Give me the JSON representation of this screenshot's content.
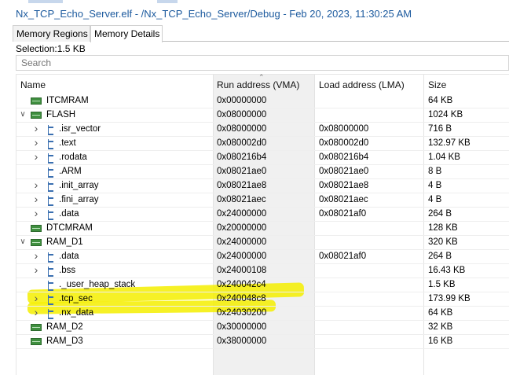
{
  "window": {
    "title": "Nx_TCP_Echo_Server.elf - /Nx_TCP_Echo_Server/Debug - Feb 20, 2023, 11:30:25 AM"
  },
  "tabs": [
    {
      "label": "Memory Regions",
      "active": false
    },
    {
      "label": "Memory Details",
      "active": true
    }
  ],
  "selection": "Selection:1.5 KB",
  "search": {
    "placeholder": "Search",
    "value": ""
  },
  "table": {
    "columns": [
      "Name",
      "Run address (VMA)",
      "Load address (LMA)",
      "Size"
    ],
    "rows": [
      {
        "name": "ITCMRAM",
        "kind": "memory",
        "twisty": "",
        "vma": "0x00000000",
        "lma": "",
        "size": "64 KB"
      },
      {
        "name": "FLASH",
        "kind": "memory",
        "twisty": "expanded",
        "vma": "0x08000000",
        "lma": "",
        "size": "1024 KB"
      },
      {
        "name": ".isr_vector",
        "kind": "section",
        "twisty": "collapsed",
        "vma": "0x08000000",
        "lma": "0x08000000",
        "size": "716 B"
      },
      {
        "name": ".text",
        "kind": "section",
        "twisty": "collapsed",
        "vma": "0x080002d0",
        "lma": "0x080002d0",
        "size": "132.97 KB"
      },
      {
        "name": ".rodata",
        "kind": "section",
        "twisty": "collapsed",
        "vma": "0x080216b4",
        "lma": "0x080216b4",
        "size": "1.04 KB"
      },
      {
        "name": ".ARM",
        "kind": "section",
        "twisty": "",
        "vma": "0x08021ae0",
        "lma": "0x08021ae0",
        "size": "8 B"
      },
      {
        "name": ".init_array",
        "kind": "section",
        "twisty": "collapsed",
        "vma": "0x08021ae8",
        "lma": "0x08021ae8",
        "size": "4 B"
      },
      {
        "name": ".fini_array",
        "kind": "section",
        "twisty": "collapsed",
        "vma": "0x08021aec",
        "lma": "0x08021aec",
        "size": "4 B"
      },
      {
        "name": ".data",
        "kind": "section",
        "twisty": "collapsed",
        "vma": "0x24000000",
        "lma": "0x08021af0",
        "size": "264 B"
      },
      {
        "name": "DTCMRAM",
        "kind": "memory",
        "twisty": "",
        "vma": "0x20000000",
        "lma": "",
        "size": "128 KB"
      },
      {
        "name": "RAM_D1",
        "kind": "memory",
        "twisty": "expanded",
        "vma": "0x24000000",
        "lma": "",
        "size": "320 KB"
      },
      {
        "name": ".data",
        "kind": "section",
        "twisty": "collapsed",
        "vma": "0x24000000",
        "lma": "0x08021af0",
        "size": "264 B"
      },
      {
        "name": ".bss",
        "kind": "section",
        "twisty": "collapsed",
        "vma": "0x24000108",
        "lma": "",
        "size": "16.43 KB"
      },
      {
        "name": "._user_heap_stack",
        "kind": "section",
        "twisty": "",
        "vma": "0x240042c4",
        "lma": "",
        "size": "1.5 KB"
      },
      {
        "name": ".tcp_sec",
        "kind": "section",
        "twisty": "collapsed",
        "vma": "0x240048c8",
        "lma": "",
        "size": "173.99 KB"
      },
      {
        "name": ".nx_data",
        "kind": "section",
        "twisty": "collapsed",
        "vma": "0x24030200",
        "lma": "",
        "size": "64 KB"
      },
      {
        "name": "RAM_D2",
        "kind": "memory",
        "twisty": "",
        "vma": "0x30000000",
        "lma": "",
        "size": "32 KB"
      },
      {
        "name": "RAM_D3",
        "kind": "memory",
        "twisty": "",
        "vma": "0x38000000",
        "lma": "",
        "size": "16 KB"
      }
    ]
  },
  "colors": {
    "title": "#1c5a9e",
    "highlight": "#f4ef00",
    "memory_icon": "#3f8f3f",
    "section_icon": "#3a6fb0"
  }
}
